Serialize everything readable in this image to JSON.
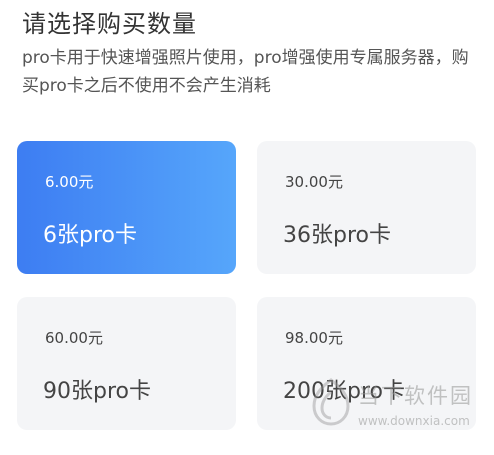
{
  "header": {
    "title": "请选择购买数量",
    "description": "pro卡用于快速增强照片使用，pro增强使用专属服务器，购买pro卡之后不使用不会产生消耗"
  },
  "options": [
    {
      "price": "6.00元",
      "quantity": "6张pro卡",
      "selected": true
    },
    {
      "price": "30.00元",
      "quantity": "36张pro卡",
      "selected": false
    },
    {
      "price": "60.00元",
      "quantity": "90张pro卡",
      "selected": false
    },
    {
      "price": "98.00元",
      "quantity": "200张pro卡",
      "selected": false
    }
  ],
  "watermark": {
    "site_name": "当下软件园",
    "url": "www.downxia.com"
  },
  "colors": {
    "selected_gradient_start": "#3d7df2",
    "selected_gradient_end": "#56a6fb",
    "card_background": "#f4f5f7",
    "text_primary": "#333333"
  }
}
